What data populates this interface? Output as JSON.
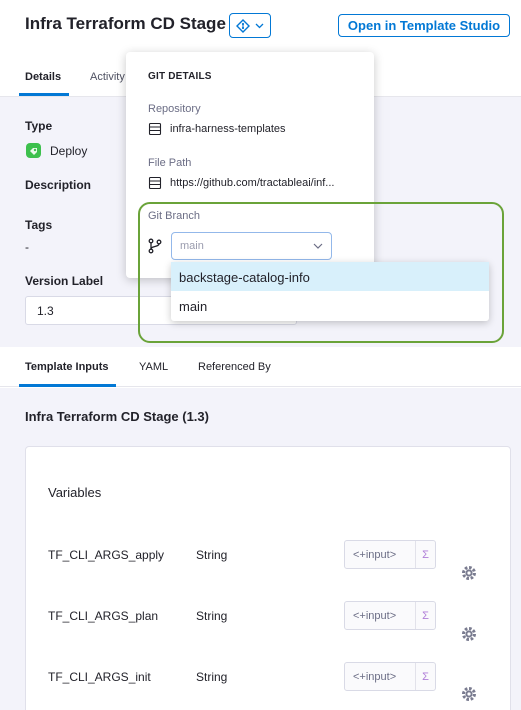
{
  "header": {
    "title": "Infra Terraform CD Stage",
    "open_button": "Open in Template Studio"
  },
  "tabs": [
    {
      "label": "Details",
      "active": true
    },
    {
      "label": "Activity",
      "active": false
    }
  ],
  "details": {
    "type_label": "Type",
    "type_value": "Deploy",
    "description_label": "Description",
    "tags_label": "Tags",
    "tags_value": "-",
    "version_label": "Version Label",
    "version_value": "1.3"
  },
  "lower_tabs": [
    {
      "label": "Template Inputs",
      "active": true
    },
    {
      "label": "YAML",
      "active": false
    },
    {
      "label": "Referenced By",
      "active": false
    }
  ],
  "template_inputs": {
    "title": "Infra Terraform CD Stage (1.3)",
    "variables_heading": "Variables",
    "variables": [
      {
        "name": "TF_CLI_ARGS_apply",
        "type": "String",
        "value": "<+input>"
      },
      {
        "name": "TF_CLI_ARGS_plan",
        "type": "String",
        "value": "<+input>"
      },
      {
        "name": "TF_CLI_ARGS_init",
        "type": "String",
        "value": "<+input>"
      }
    ]
  },
  "git_details": {
    "title": "GIT DETAILS",
    "repository_label": "Repository",
    "repository_value": "infra-harness-templates",
    "file_path_label": "File Path",
    "file_path_value": "https://github.com/tractableai/inf...",
    "branch_label": "Git Branch",
    "branch_value": "main",
    "branch_options": [
      "backstage-catalog-info",
      "main"
    ],
    "highlighted_option": "backstage-catalog-info"
  },
  "colors": {
    "accent": "#0278d5",
    "highlight_box": "#6aa339",
    "deploy_icon": "#3dc04d",
    "option_highlight": "#d8f0fb"
  }
}
